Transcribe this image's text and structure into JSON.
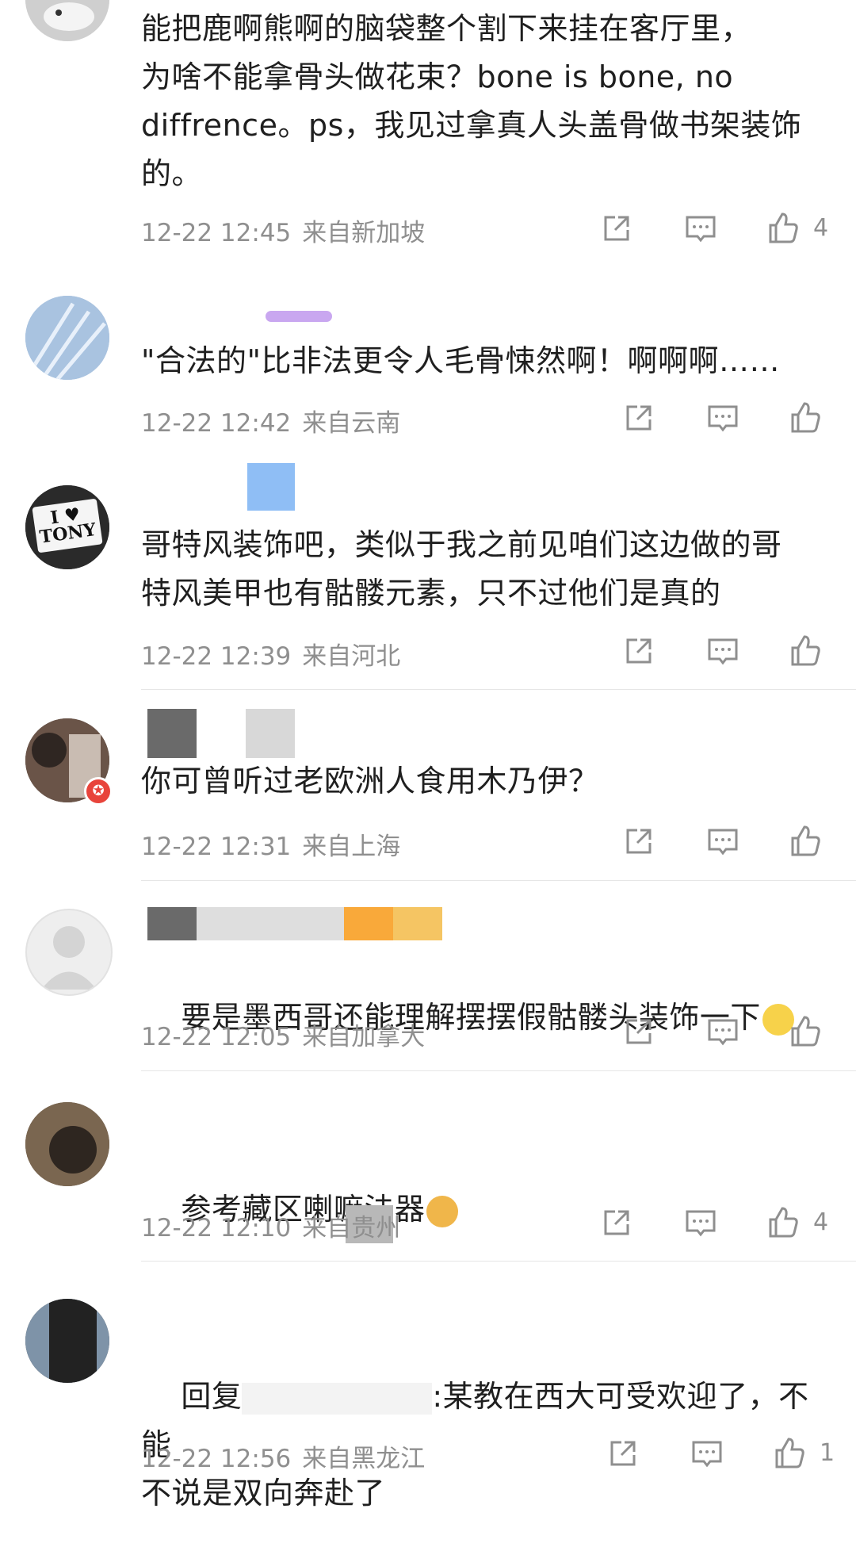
{
  "comments": [
    {
      "text": "能把鹿啊熊啊的脑袋整个割下来挂在客厅里，\n为啥不能拿骨头做花束？bone is bone, no\ndiffrence。ps，我见过拿真人头盖骨做书架装饰\n的。",
      "time": "12-22 12:45",
      "location": "来自新加坡",
      "likes": "4"
    },
    {
      "text": "\"合法的\"比非法更令人毛骨悚然啊！啊啊啊……",
      "time": "12-22 12:42",
      "location": "来自云南",
      "likes": ""
    },
    {
      "text": "哥特风装饰吧，类似于我之前见咱们这边做的哥\n特风美甲也有骷髅元素，只不过他们是真的",
      "time": "12-22 12:39",
      "location": "来自河北",
      "likes": ""
    },
    {
      "text": "你可曾听过老欧洲人食用木乃伊？",
      "time": "12-22 12:31",
      "location": "来自上海",
      "likes": ""
    },
    {
      "text": "要是墨西哥还能理解摆摆假骷髅头装饰一下",
      "time": "12-22 12:05",
      "location": "来自加拿大",
      "likes": ""
    },
    {
      "text": "参考藏区喇嘛法器",
      "time": "12-22 12:10",
      "location": "来自贵州",
      "likes": "4"
    },
    {
      "text_a": "回复",
      "text_b": ":某教在西大可受欢迎了，不能\n不说是双向奔赴了",
      "time": "12-22 12:56",
      "location": "来自黑龙江",
      "likes": "1"
    }
  ],
  "avatar_badges": {
    "tony_line1": "I ♥",
    "tony_line2": "TONY"
  },
  "icons": [
    "share-icon",
    "comment-icon",
    "like-icon",
    "star-badge-icon",
    "emoji-face-icon",
    "emoji-dog-icon"
  ],
  "colors": {
    "text": "#1f1f1f",
    "meta": "#8f8f8f",
    "divider": "#e6e6e6",
    "accent_blue": "#8fbef5",
    "accent_orange": "#f9a93a"
  }
}
